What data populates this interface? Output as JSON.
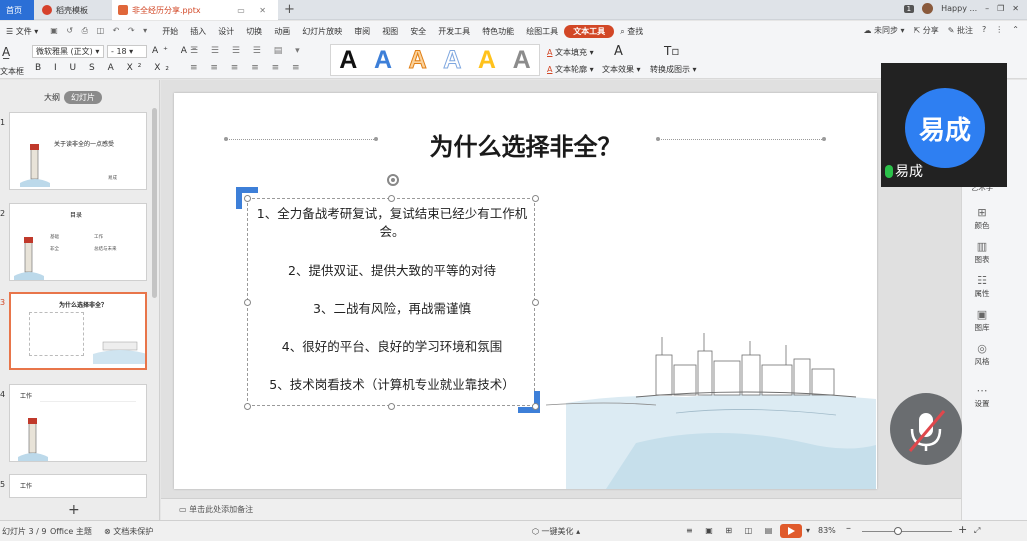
{
  "tabs": {
    "home": "首页",
    "template": "稻壳模板",
    "file": "非全经历分享.pptx",
    "user": "Happy ..."
  },
  "menu": {
    "file": "文件",
    "items": [
      "开始",
      "插入",
      "设计",
      "切换",
      "动画",
      "幻灯片放映",
      "审阅",
      "视图",
      "安全",
      "开发工具",
      "特色功能",
      "绘图工具"
    ],
    "active": "文本工具",
    "search": "查找",
    "sync": "未同步",
    "share": "分享",
    "comment": "批注"
  },
  "ribbon": {
    "textbox": "文本框",
    "font": "微软雅黑 (正文)",
    "size": "18",
    "format_row": "B I U S A X² X₂",
    "align_row": "≡ ≡ ≡ ≡ ≡ ≡",
    "style_letter": "A",
    "fill": "文本填充",
    "outline": "文本轮廓",
    "effect": "文本效果",
    "convert": "转换成图示"
  },
  "left_panel": {
    "outline": "大纲",
    "slides": "幻灯片",
    "thumb1_title": "关于读非全的一点感受",
    "thumb1_sub": "易成",
    "thumb2_title": "目录",
    "thumb2_items": [
      "基础",
      "工作",
      "非全",
      "总结与未来"
    ],
    "thumb3_title": "为什么选择非全？",
    "thumb4_title": "工作",
    "thumb5_title": "工作"
  },
  "slide": {
    "title": "为什么选择非全？",
    "items": [
      "1、全力备战考研复试，复试结束已经少有工作机会。",
      "2、提供双证、提供大致的平等的对待",
      "3、二战有风险，再战需谨慎",
      "4、很好的平台、良好的学习环境和氛围",
      "5、技术岗看技术（计算机专业就业靠技术）"
    ]
  },
  "notes_placeholder": "单击此处添加备注",
  "right_panel": {
    "items": [
      "艺术字",
      "颜色",
      "图表",
      "属性",
      "图库",
      "风格",
      "设置"
    ]
  },
  "video": {
    "avatar_text": "易成",
    "name": "易成"
  },
  "status": {
    "slide_index": "幻灯片 3 / 9",
    "theme": "Office 主题",
    "protect": "文档未保护",
    "beautify": "一键美化",
    "zoom": "83%"
  }
}
